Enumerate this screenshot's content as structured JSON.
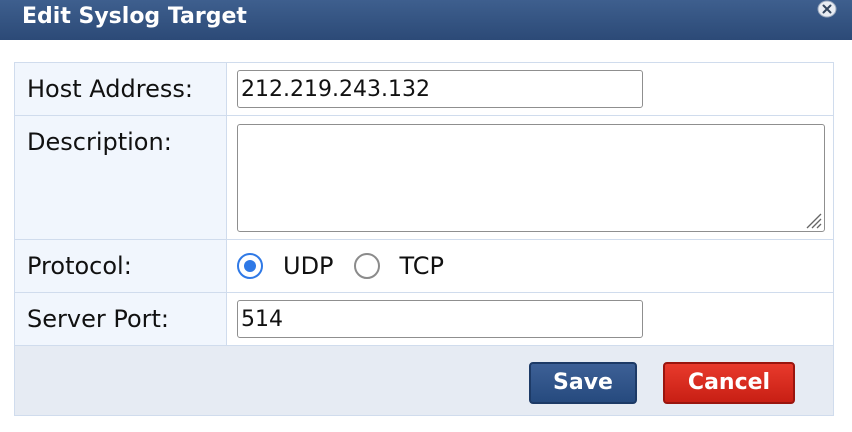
{
  "dialog": {
    "title": "Edit Syslog Target",
    "close_icon": "close-icon"
  },
  "form": {
    "host_address": {
      "label": "Host Address:",
      "value": "212.219.243.132"
    },
    "description": {
      "label": "Description:",
      "value": ""
    },
    "protocol": {
      "label": "Protocol:",
      "options": [
        {
          "label": "UDP",
          "checked": true
        },
        {
          "label": "TCP",
          "checked": false
        }
      ]
    },
    "server_port": {
      "label": "Server Port:",
      "value": "514"
    }
  },
  "footer": {
    "save_label": "Save",
    "cancel_label": "Cancel"
  },
  "colors": {
    "titlebar": "#2c4a77",
    "radio_accent": "#2f79e6",
    "save_button": "#264a7e",
    "cancel_button": "#c81f14"
  }
}
